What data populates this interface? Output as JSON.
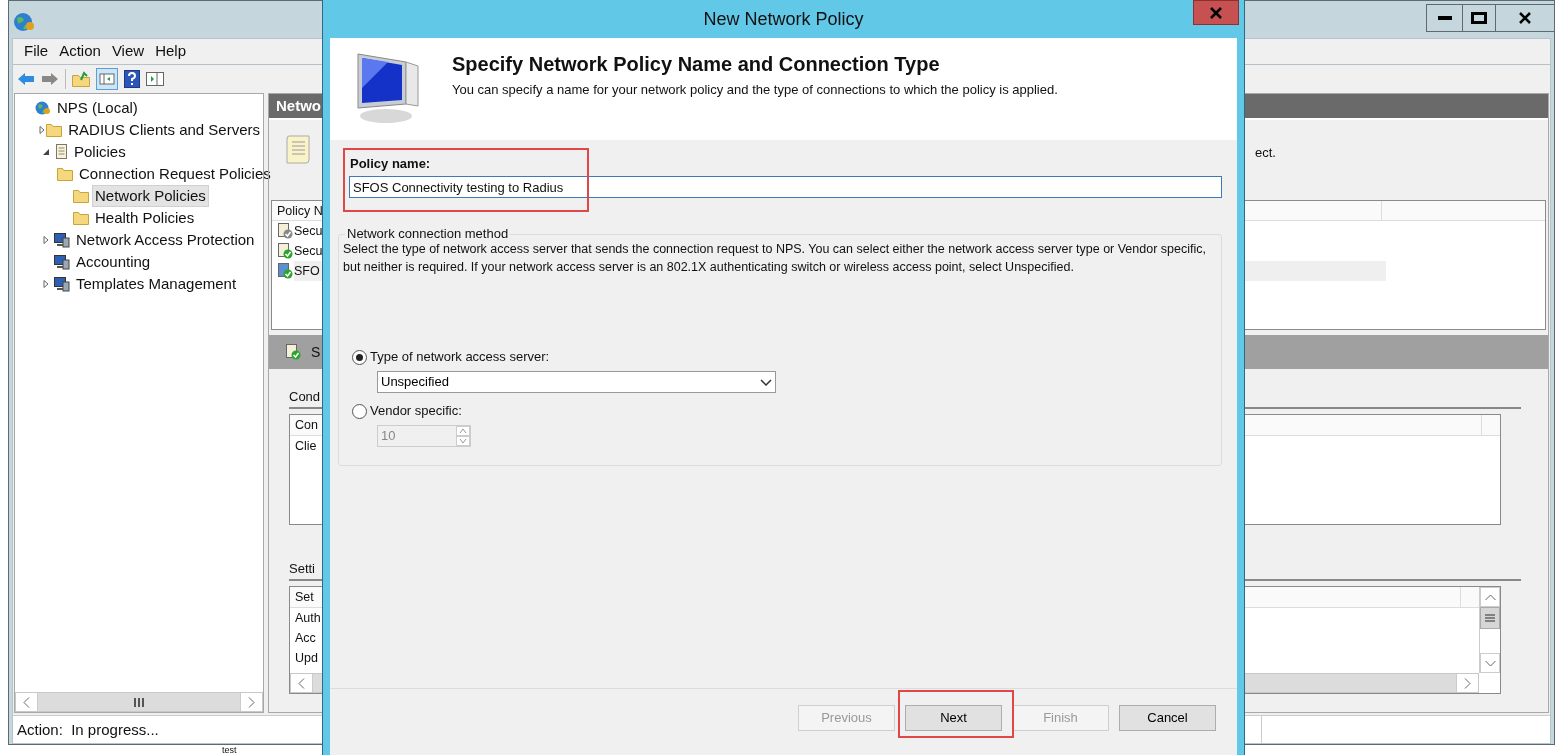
{
  "main_window": {
    "menu": [
      "File",
      "Action",
      "View",
      "Help"
    ],
    "tree": [
      {
        "label": "NPS (Local)",
        "kind": "root",
        "selected": false,
        "children": [
          {
            "label": "RADIUS Clients and Servers",
            "kind": "folder",
            "expanded": false,
            "selected": false
          },
          {
            "label": "Policies",
            "kind": "document",
            "expanded": true,
            "selected": false,
            "children": [
              {
                "label": "Connection Request Policies",
                "kind": "folder",
                "selected": false
              },
              {
                "label": "Network Policies",
                "kind": "folder",
                "selected": true
              },
              {
                "label": "Health Policies",
                "kind": "folder",
                "selected": false
              }
            ]
          },
          {
            "label": "Network Access Protection",
            "kind": "computer",
            "expanded": false,
            "selected": false
          },
          {
            "label": "Accounting",
            "kind": "computer",
            "selected": false
          },
          {
            "label": "Templates Management",
            "kind": "computer",
            "expanded": false,
            "selected": false
          }
        ]
      }
    ],
    "right_panel": {
      "header": "Netwo",
      "description_end": "ect.",
      "table": {
        "column_1": "Policy N",
        "rows": [
          {
            "text": "Secu",
            "kind": "disabled",
            "selected": false
          },
          {
            "text": "Secu",
            "kind": "enabled",
            "selected": false
          },
          {
            "text": "SFO",
            "kind": "new",
            "selected": true
          }
        ]
      },
      "detail_header": "S",
      "conditions": {
        "label": "Cond",
        "column_1": "Con",
        "rows": [
          "Clie"
        ]
      },
      "settings": {
        "label": "Setti",
        "column_1": "Set",
        "rows": [
          "Auth",
          "Acc",
          "Upd"
        ]
      }
    },
    "status_bar": "Action:  In progress...",
    "below_text": "test"
  },
  "dialog": {
    "title": "New Network Policy",
    "heading": "Specify Network Policy Name and Connection Type",
    "subheading": "You can specify a name for your network policy and the type of connections to which the policy is applied.",
    "policy_name": {
      "label": "Policy name:",
      "value": "SFOS Connectivity testing to Radius"
    },
    "connection_method": {
      "label": "Network connection method",
      "description": "Select the type of network access server that sends the connection request to NPS. You can select either the network access server type or Vendor specific, but neither is required.  If your network access server is an 802.1X authenticating switch or wireless access point, select Unspecified.",
      "options": [
        {
          "label": "Type of network access server:",
          "selected": true,
          "kind": "dropdown",
          "value": "Unspecified"
        },
        {
          "label": "Vendor specific:",
          "selected": false,
          "kind": "spinner",
          "value": "10"
        }
      ]
    },
    "buttons": [
      {
        "label": "Previous",
        "disabled": true
      },
      {
        "label": "Next",
        "disabled": false
      },
      {
        "label": "Finish",
        "disabled": true
      },
      {
        "label": "Cancel",
        "disabled": false
      }
    ]
  }
}
